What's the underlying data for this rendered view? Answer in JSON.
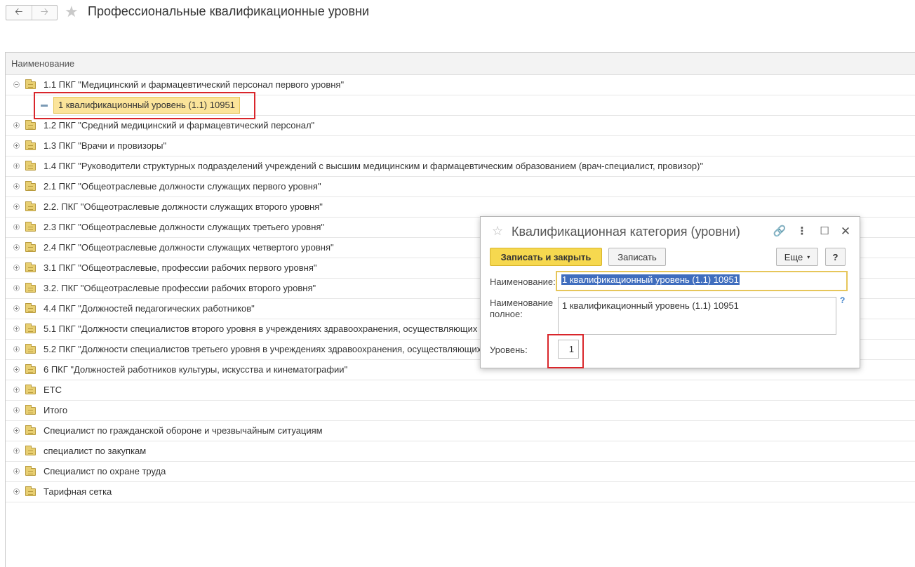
{
  "header": {
    "back_icon": "arrow-left",
    "forward_icon": "arrow-right",
    "favorite_icon": "star",
    "title": "Профессиональные квалификационные уровни"
  },
  "list": {
    "column_header": "Наименование",
    "rows": [
      {
        "label": "1.1 ПКГ \"Медицинский и фармацевтический персонал первого уровня\"",
        "expanded": true
      },
      {
        "label": "1 квалификационный уровень (1.1) 10951",
        "child": true,
        "selected": true
      },
      {
        "label": "1.2 ПКГ \"Средний медицинский и фармацевтический персонал\""
      },
      {
        "label": "1.3 ПКГ \"Врачи и провизоры\""
      },
      {
        "label": "1.4 ПКГ \"Руководители структурных подразделений учреждений с высшим медицинским и фармацевтическим образованием (врач-специалист, провизор)\""
      },
      {
        "label": "2.1 ПКГ \"Общеотраслевые должности служащих первого уровня\""
      },
      {
        "label": "2.2. ПКГ \"Общеотраслевые должности служащих второго уровня\""
      },
      {
        "label": "2.3 ПКГ \"Общеотраслевые должности служащих третьего уровня\""
      },
      {
        "label": "2.4 ПКГ \"Общеотраслевые должности служащих четвертого уровня\""
      },
      {
        "label": "3.1 ПКГ \"Общеотраслевые, профессии рабочих первого уровня\""
      },
      {
        "label": "3.2. ПКГ \"Общеотраслевые профессии рабочих второго уровня\""
      },
      {
        "label": "4.4 ПКГ \"Должностей педагогических работников\""
      },
      {
        "label": "5.1 ПКГ \"Должности специалистов второго уровня в учреждениях здравоохранения, осуществляющих"
      },
      {
        "label": "5.2 ПКГ \"Должности специалистов третьего уровня в учреждениях здравоохранения, осуществляющих"
      },
      {
        "label": "6 ПКГ \"Должностей работников культуры, искусства и кинематографии\""
      },
      {
        "label": "ЕТС"
      },
      {
        "label": "Итого"
      },
      {
        "label": "Специалист по гражданской обороне и чрезвычайным ситуациям"
      },
      {
        "label": "специалист по закупкам"
      },
      {
        "label": "Специалист по охране труда"
      },
      {
        "label": "Тарифная сетка"
      }
    ]
  },
  "dialog": {
    "title": "Квалификационная категория (уровни)",
    "favorite_icon": "☆",
    "link_icon": "🔗",
    "more_icon": "⋮",
    "maximize_icon": "☐",
    "close_icon": "✕",
    "save_close_label": "Записать и закрыть",
    "save_label": "Записать",
    "more_label": "Еще",
    "more_caret": "▾",
    "help_label": "?",
    "name_label": "Наименование:",
    "name_value": "1 квалификационный уровень (1.1) 10951",
    "full_name_label_1": "Наименование",
    "full_name_label_2": "полное:",
    "full_name_value": "1 квалификационный уровень (1.1) 10951",
    "full_name_help": "?",
    "level_label": "Уровень:",
    "level_value": "1"
  }
}
